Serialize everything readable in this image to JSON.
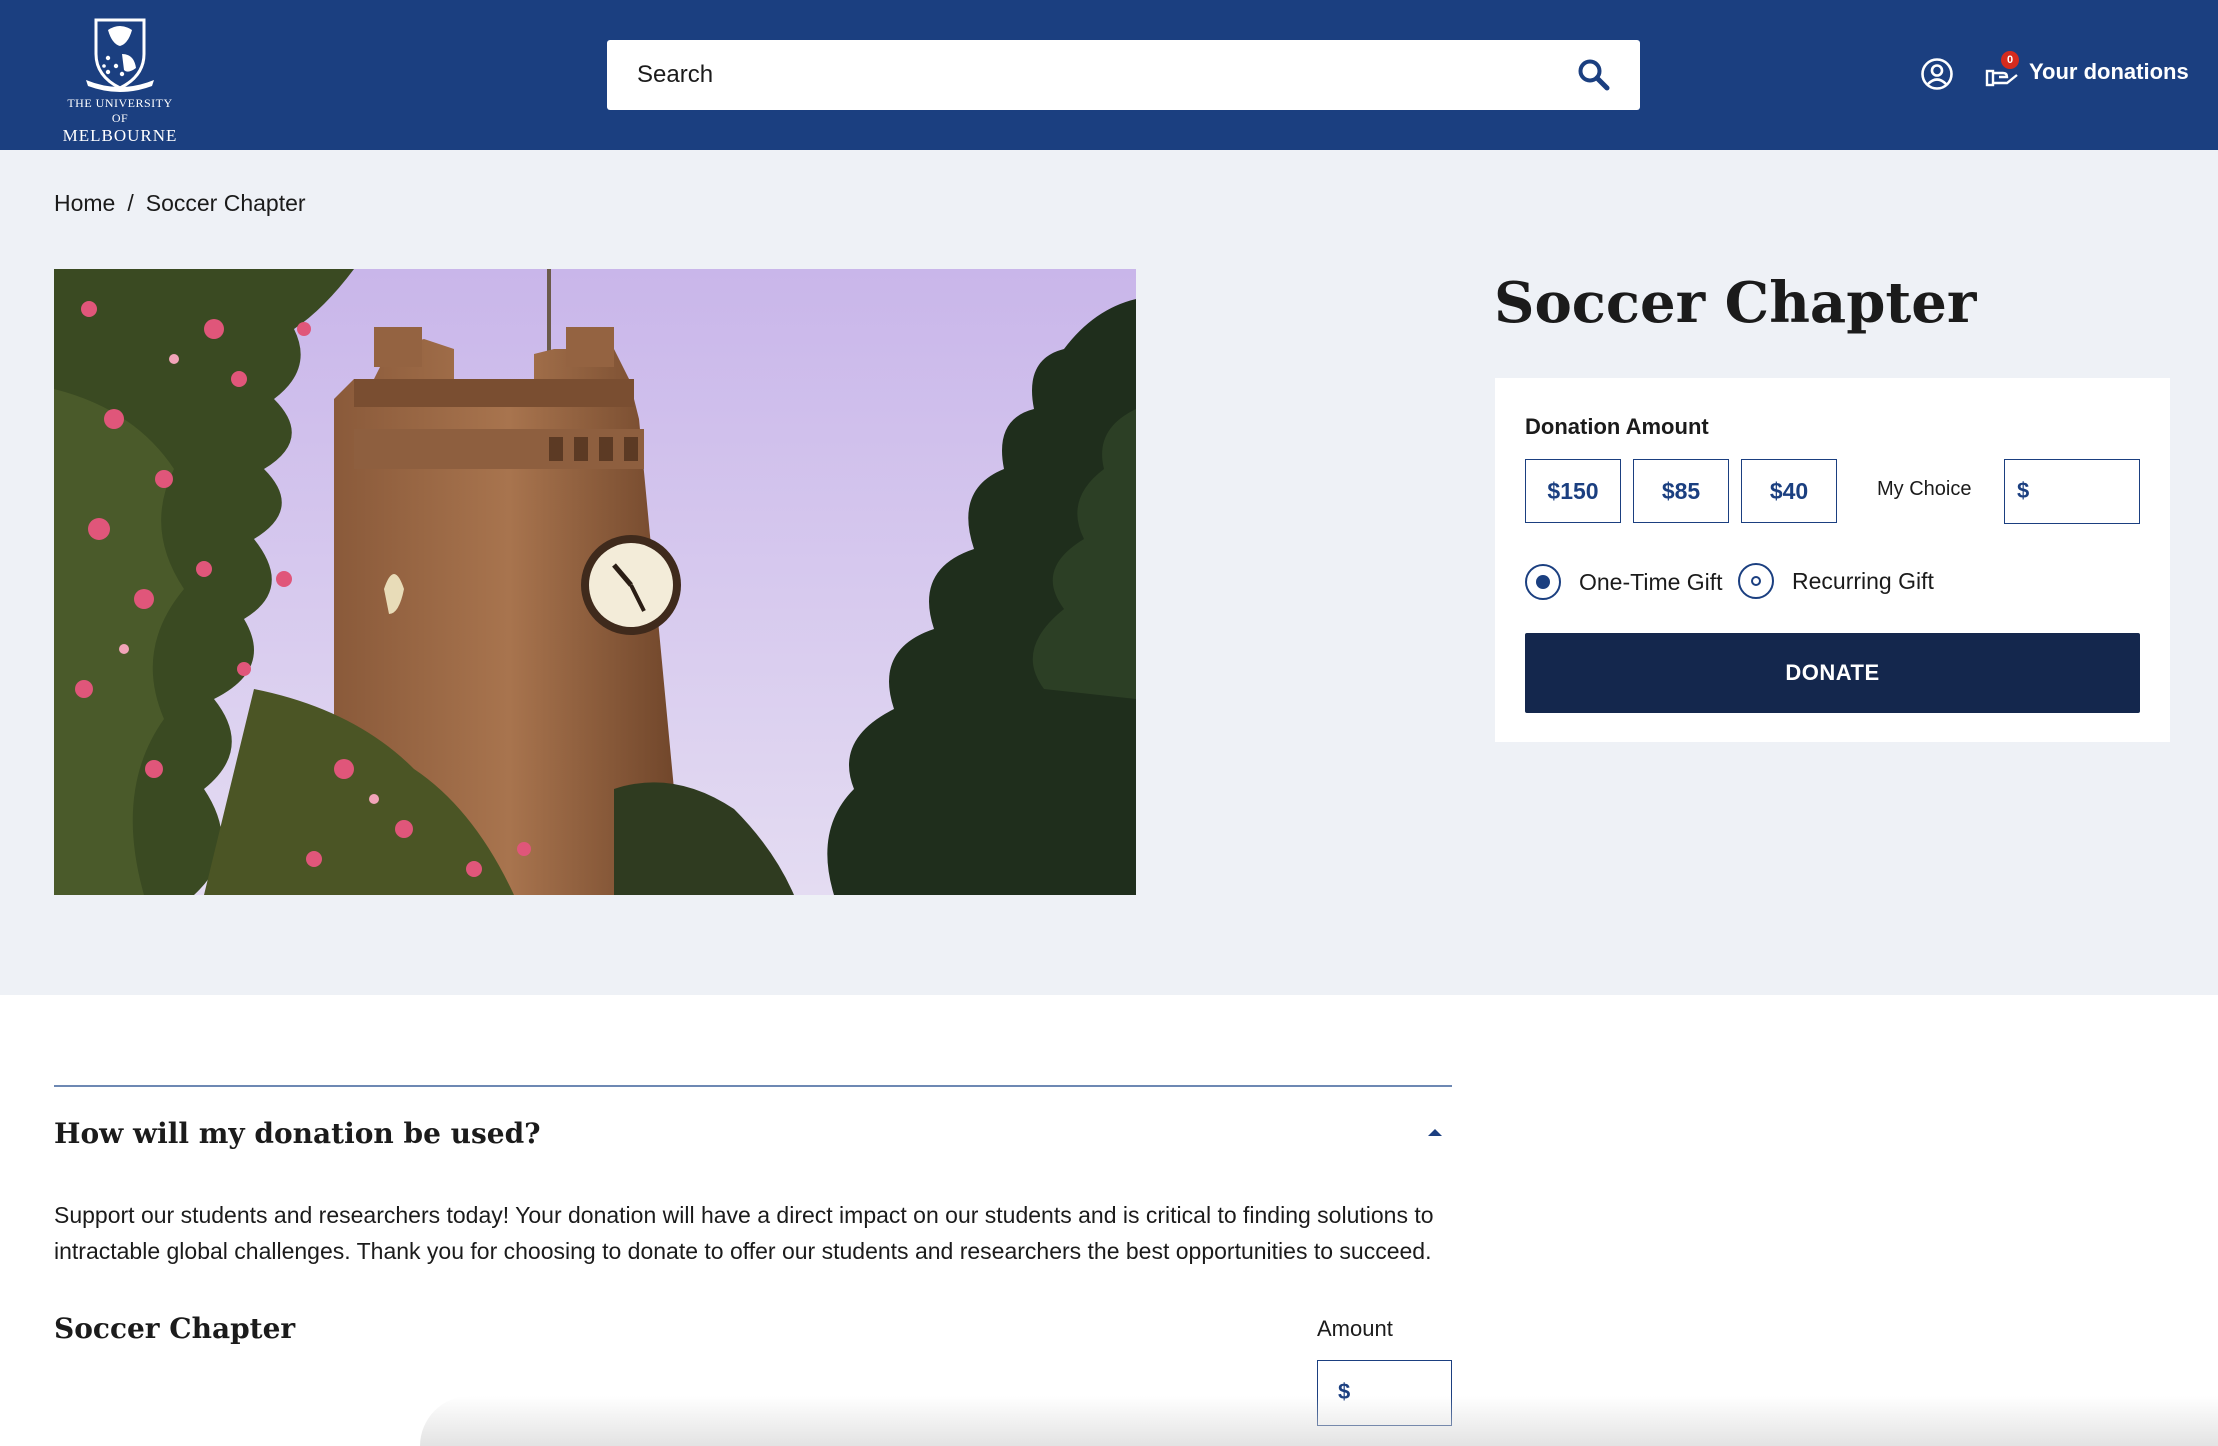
{
  "header": {
    "logo_line1": "THE UNIVERSITY OF",
    "logo_line2": "MELBOURNE",
    "search_placeholder": "Search",
    "donations_label": "Your donations",
    "cart_count": "0"
  },
  "breadcrumb": {
    "home": "Home",
    "separator": "/",
    "current": "Soccer Chapter"
  },
  "donation_panel": {
    "title": "Soccer Chapter",
    "amount_label": "Donation Amount",
    "amounts": [
      "$150",
      "$85",
      "$40"
    ],
    "my_choice_label": "My Choice",
    "currency_symbol": "$",
    "custom_value": "",
    "gift_types": [
      {
        "label": "One-Time Gift",
        "selected": true
      },
      {
        "label": "Recurring Gift",
        "selected": false
      }
    ],
    "donate_label": "DONATE"
  },
  "accordion": {
    "title": "How will my donation be used?",
    "body": "Support our students and researchers today! Your donation will have a direct impact on our students and is critical to finding solutions to intractable global challenges. Thank you for choosing to donate to offer our students and researchers the best opportunities to succeed."
  },
  "fund_row": {
    "name": "Soccer Chapter",
    "amount_label": "Amount",
    "currency_symbol": "$",
    "value": ""
  },
  "colors": {
    "brand_blue": "#1b3f80",
    "donate_navy": "#14274d",
    "badge_red": "#d52b1e",
    "page_bg": "#eef1f6"
  },
  "icons": {
    "search": "search-icon",
    "account": "user-circle-icon",
    "cart": "donation-hand-icon",
    "toggle": "chevron-up-icon"
  }
}
